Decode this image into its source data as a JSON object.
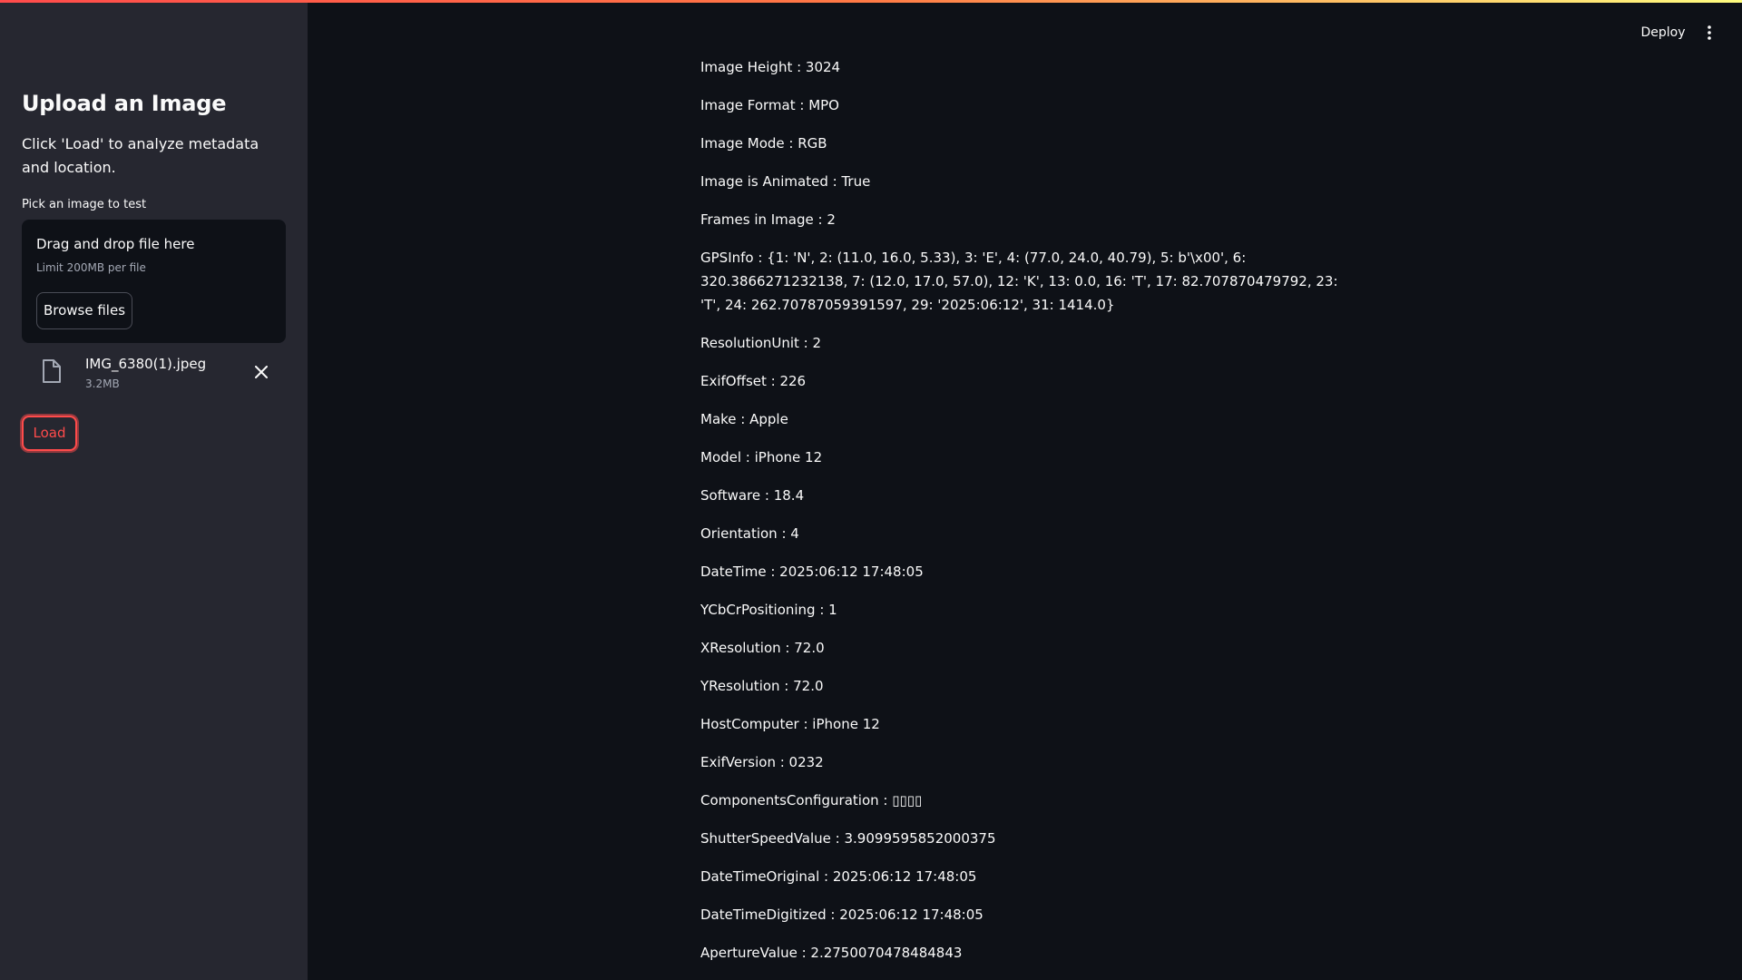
{
  "colors": {
    "accent": "#ff4b4b",
    "sidebar_bg": "#262730",
    "main_bg": "#0e1117"
  },
  "header": {
    "deploy_label": "Deploy",
    "menu_icon": "kebab-menu-icon"
  },
  "sidebar": {
    "title": "Upload an Image",
    "description": "Click 'Load' to analyze metadata and location.",
    "uploader": {
      "label": "Pick an image to test",
      "dropzone_title": "Drag and drop file here",
      "limit_text": "Limit 200MB per file",
      "browse_label": "Browse files"
    },
    "file": {
      "name": "IMG_6380(1).jpeg",
      "size": "3.2MB",
      "icon": "file-icon",
      "remove_icon": "close-icon"
    },
    "load_label": "Load"
  },
  "metadata": [
    "Image Height : 3024",
    "Image Format : MPO",
    "Image Mode : RGB",
    "Image is Animated : True",
    "Frames in Image : 2",
    "GPSInfo : {1: 'N', 2: (11.0, 16.0, 5.33), 3: 'E', 4: (77.0, 24.0, 40.79), 5: b'\\x00', 6: 320.3866271232138, 7: (12.0, 17.0, 57.0), 12: 'K', 13: 0.0, 16: 'T', 17: 82.707870479792, 23: 'T', 24: 262.70787059391597, 29: '2025:06:12', 31: 1414.0}",
    "ResolutionUnit : 2",
    "ExifOffset : 226",
    "Make : Apple",
    "Model : iPhone 12",
    "Software : 18.4",
    "Orientation : 4",
    "DateTime : 2025:06:12 17:48:05",
    "YCbCrPositioning : 1",
    "XResolution : 72.0",
    "YResolution : 72.0",
    "HostComputer : iPhone 12",
    "ExifVersion : 0232",
    "ComponentsConfiguration : ▯▯▯▯",
    "ShutterSpeedValue : 3.9099595852000375",
    "DateTimeOriginal : 2025:06:12 17:48:05",
    "DateTimeDigitized : 2025:06:12 17:48:05",
    "ApertureValue : 2.2750070478484843"
  ]
}
